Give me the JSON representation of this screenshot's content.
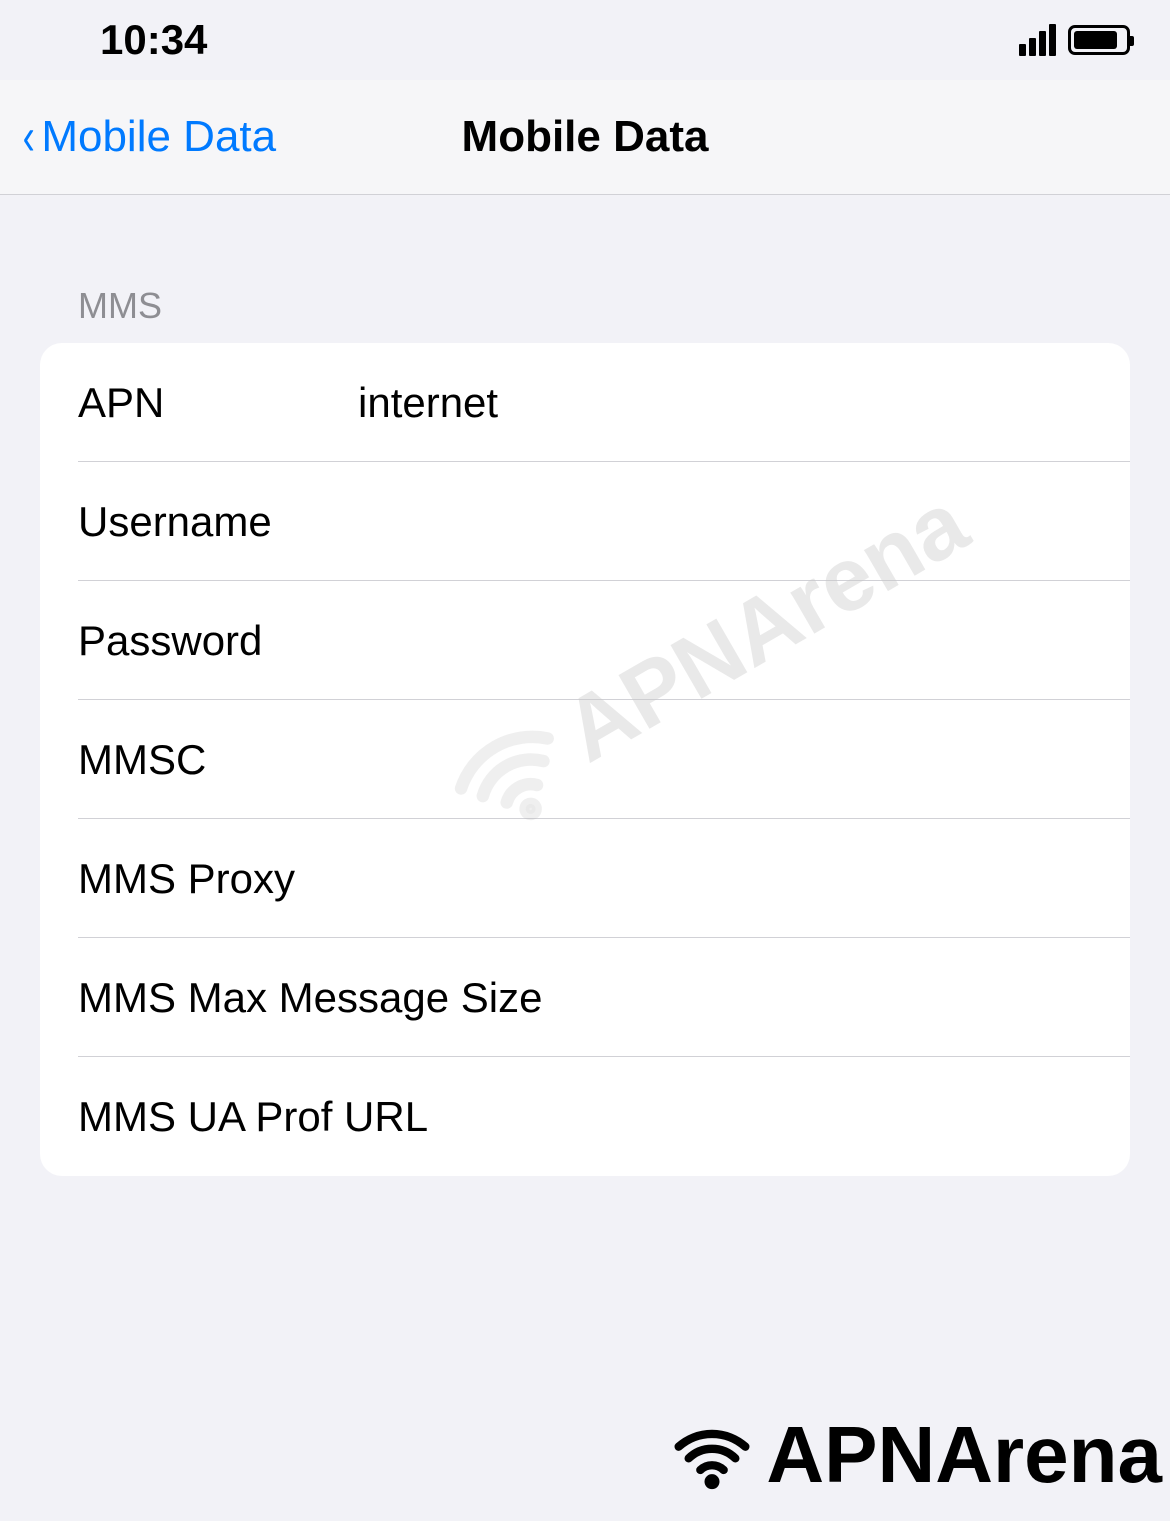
{
  "status_bar": {
    "time": "10:34"
  },
  "nav": {
    "back_label": "Mobile Data",
    "title": "Mobile Data"
  },
  "section": {
    "header": "MMS",
    "rows": [
      {
        "label": "APN",
        "value": "internet"
      },
      {
        "label": "Username",
        "value": ""
      },
      {
        "label": "Password",
        "value": ""
      },
      {
        "label": "MMSC",
        "value": ""
      },
      {
        "label": "MMS Proxy",
        "value": ""
      },
      {
        "label": "MMS Max Message Size",
        "value": ""
      },
      {
        "label": "MMS UA Prof URL",
        "value": ""
      }
    ]
  },
  "watermark": {
    "text": "APNArena"
  },
  "footer": {
    "text": "APNArena"
  }
}
